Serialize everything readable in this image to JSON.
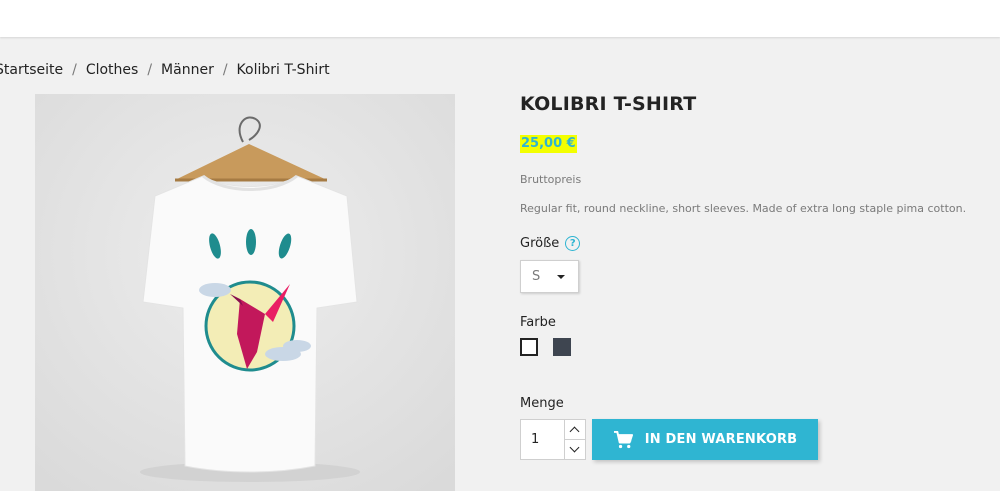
{
  "breadcrumb": [
    "Startseite",
    "Clothes",
    "Männer",
    "Kolibri T-Shirt"
  ],
  "product": {
    "title": "KOLIBRI T-SHIRT",
    "price": "25,00 €",
    "tax_label": "Bruttopreis",
    "description": "Regular fit, round neckline, short sleeves. Made of extra long staple pima cotton."
  },
  "size": {
    "label": "Größe",
    "selected": "S",
    "help_icon": "question-circle-icon"
  },
  "color": {
    "label": "Farbe",
    "options": [
      "#ffffff",
      "#3e4550"
    ],
    "selected": 0
  },
  "quantity": {
    "label": "Menge",
    "value": "1"
  },
  "cart": {
    "label": "IN DEN WARENKORB",
    "icon": "shopping-cart-icon"
  },
  "colors": {
    "accent": "#2fb5d2",
    "price_highlight": "#f3ff00",
    "text": "#232323",
    "muted": "#7a7a7a"
  }
}
